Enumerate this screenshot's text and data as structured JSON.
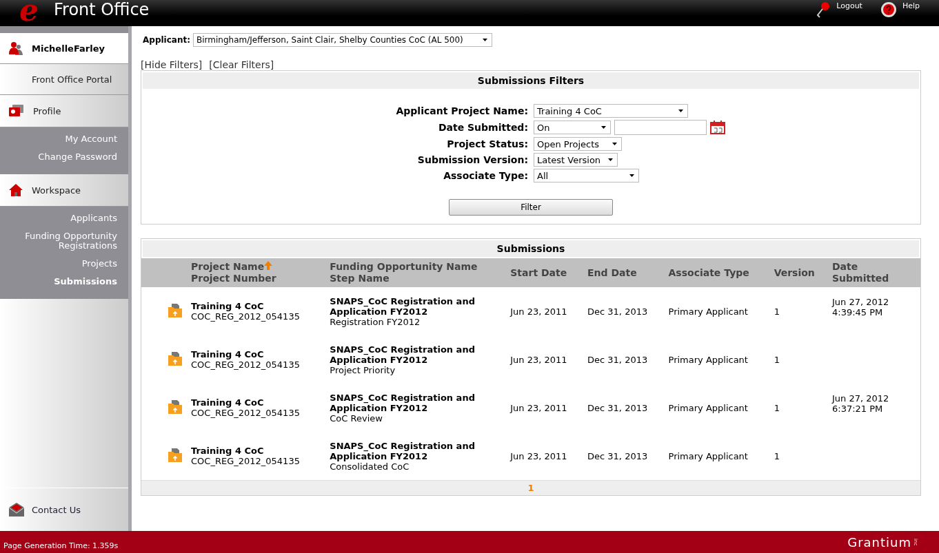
{
  "header": {
    "logo_mark": "e",
    "title": "Front Office",
    "actions": [
      {
        "kind": "logout",
        "label": "Logout"
      },
      {
        "kind": "help",
        "label": "Help"
      }
    ]
  },
  "sidebar": {
    "user": "MichelleFarley",
    "portal": "Front Office Portal",
    "sections": [
      {
        "kind": "profile",
        "label": "Profile",
        "items": [
          {
            "label": "My Account",
            "selected": false
          },
          {
            "label": "Change Password",
            "selected": false
          }
        ]
      },
      {
        "kind": "workspace",
        "label": "Workspace",
        "items": [
          {
            "label": "Applicants",
            "selected": false
          },
          {
            "label": "Funding Opportunity Registrations",
            "selected": false
          },
          {
            "label": "Projects",
            "selected": false
          },
          {
            "label": "Submissions",
            "selected": true
          }
        ]
      }
    ],
    "contact": "Contact Us"
  },
  "applicant": {
    "label": "Applicant:",
    "value": "Birmingham/Jefferson, Saint Clair, Shelby Counties CoC (AL 500)"
  },
  "filter_links": [
    "[Hide Filters]",
    "[Clear Filters]"
  ],
  "filters": {
    "title": "Submissions Filters",
    "fields": [
      {
        "label": "Applicant Project Name:",
        "kind": "select",
        "value": "Training 4 CoC"
      },
      {
        "label": "Date Submitted:",
        "kind": "date",
        "value": "On"
      },
      {
        "label": "Project Status:",
        "kind": "select",
        "value": "Open Projects"
      },
      {
        "label": "Submission Version:",
        "kind": "select",
        "value": "Latest Version"
      },
      {
        "label": "Associate Type:",
        "kind": "select",
        "value": "All"
      }
    ],
    "button": "Filter"
  },
  "table": {
    "title": "Submissions",
    "columns": [
      {
        "lines": [
          "Project Name",
          "Project Number"
        ],
        "sorted": true
      },
      {
        "lines": [
          "Funding Opportunity Name",
          "Step Name"
        ],
        "sorted": false
      },
      {
        "lines": [
          "Start Date"
        ],
        "sorted": false
      },
      {
        "lines": [
          "End Date"
        ],
        "sorted": false
      },
      {
        "lines": [
          "Associate Type"
        ],
        "sorted": false
      },
      {
        "lines": [
          "Version"
        ],
        "sorted": false
      },
      {
        "lines": [
          "Date Submitted"
        ],
        "sorted": false
      }
    ],
    "rows": [
      {
        "project_name": "Training 4 CoC",
        "project_number": "COC_REG_2012_054135",
        "funding_opportunity": "SNAPS_CoC Registration and Application FY2012",
        "step_name": "Registration FY2012",
        "start_date": "Jun 23, 2011",
        "end_date": "Dec 31, 2013",
        "associate_type": "Primary Applicant",
        "version": "1",
        "date_submitted": "Jun 27, 2012 4:39:45 PM"
      },
      {
        "project_name": "Training 4 CoC",
        "project_number": "COC_REG_2012_054135",
        "funding_opportunity": "SNAPS_CoC Registration and Application FY2012",
        "step_name": "Project Priority",
        "start_date": "Jun 23, 2011",
        "end_date": "Dec 31, 2013",
        "associate_type": "Primary Applicant",
        "version": "1"
      },
      {
        "project_name": "Training 4 CoC",
        "project_number": "COC_REG_2012_054135",
        "funding_opportunity": "SNAPS_CoC Registration and Application FY2012",
        "step_name": "CoC Review",
        "start_date": "Jun 23, 2011",
        "end_date": "Dec 31, 2013",
        "associate_type": "Primary Applicant",
        "version": "1",
        "date_submitted": "Jun 27, 2012 6:37:21 PM"
      },
      {
        "project_name": "Training 4 CoC",
        "project_number": "COC_REG_2012_054135",
        "funding_opportunity": "SNAPS_CoC Registration and Application FY2012",
        "step_name": "Consolidated CoC",
        "start_date": "Jun 23, 2011",
        "end_date": "Dec 31, 2013",
        "associate_type": "Primary Applicant",
        "version": "1"
      }
    ],
    "pages": [
      {
        "label": "1",
        "selected": true
      }
    ]
  },
  "footer": {
    "generation_time": "Page Generation Time: 1.359s",
    "brand": "Grantium",
    "brand_suffix": "inc"
  }
}
